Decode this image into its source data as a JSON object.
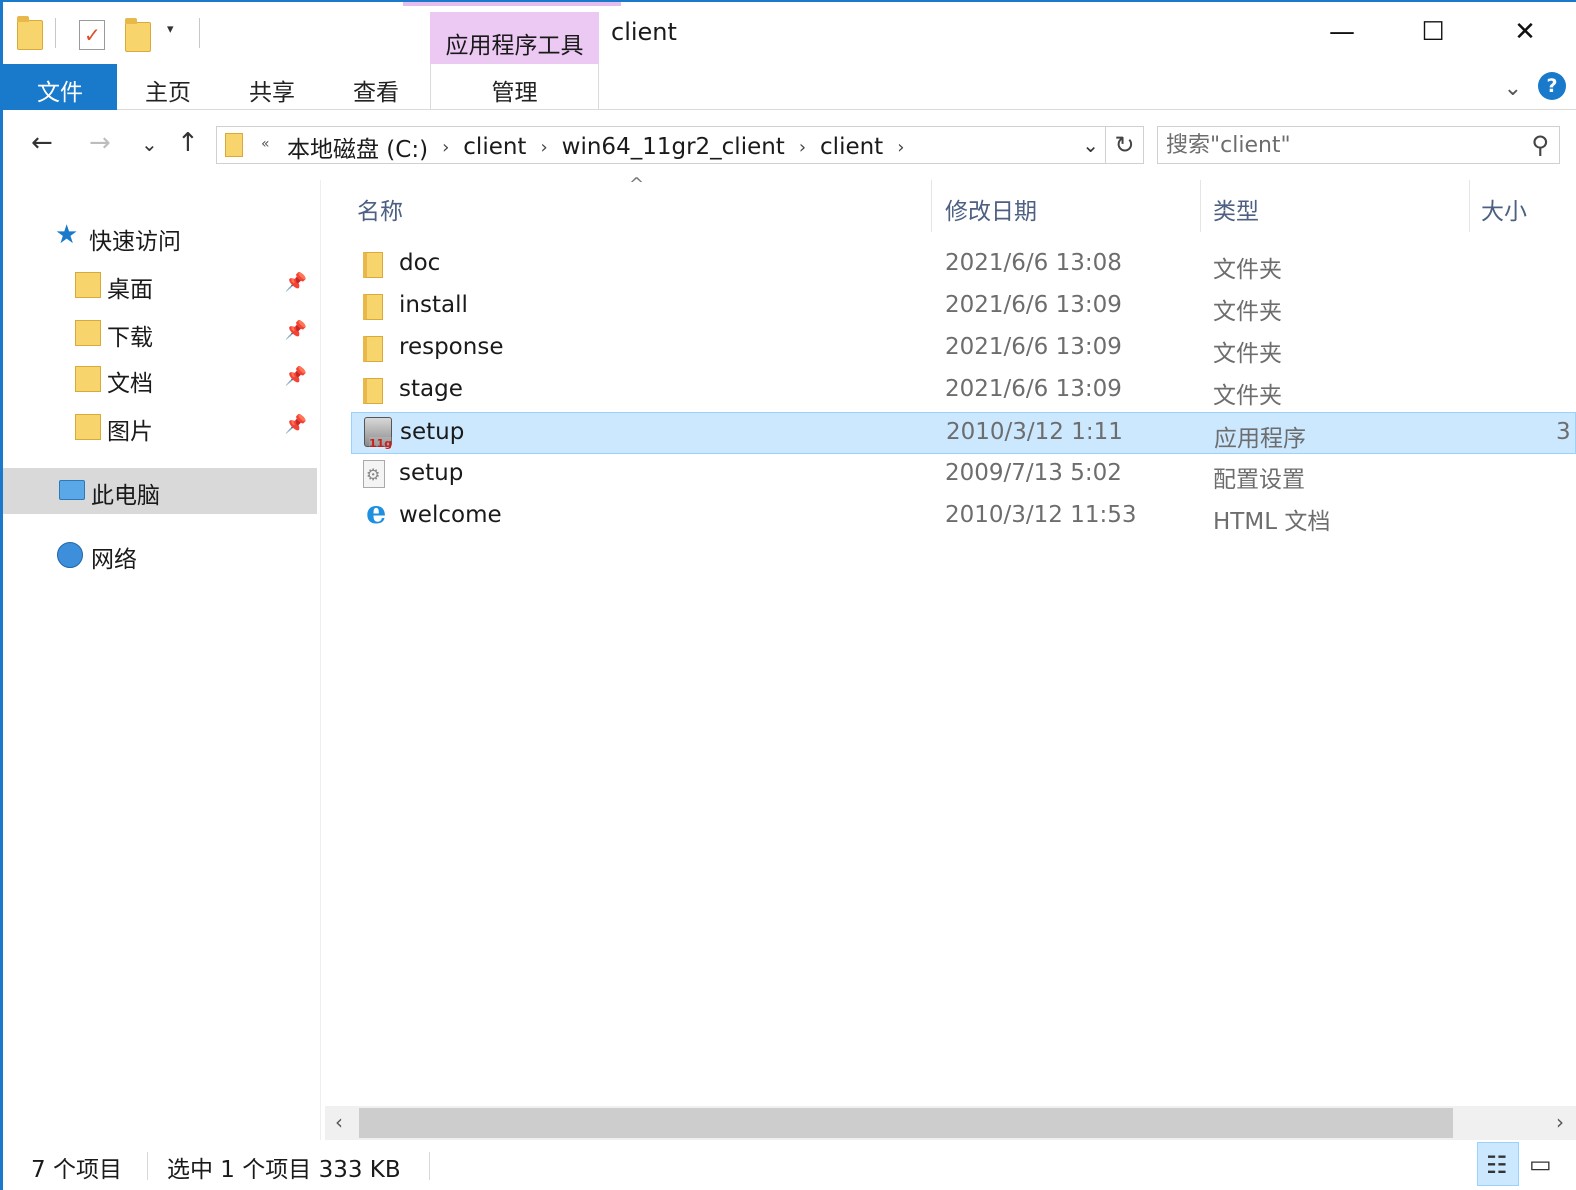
{
  "window": {
    "title": "client",
    "context_tab": "应用程序工具",
    "minimize": "—",
    "maximize": "☐",
    "close": "✕"
  },
  "ribbon": {
    "tabs": [
      "文件",
      "主页",
      "共享",
      "查看",
      "管理"
    ],
    "expand": "⌄",
    "help": "?"
  },
  "nav": {
    "back": "←",
    "forward": "→",
    "recent": "⌄",
    "up": "↑",
    "address_overflow": "«",
    "breadcrumbs": [
      "本地磁盘 (C:)",
      "client",
      "win64_11gr2_client",
      "client"
    ],
    "crumb_separator": "›",
    "address_dropdown": "⌄",
    "refresh": "↻",
    "search_placeholder": "搜索\"client\"",
    "search_icon": "⚲"
  },
  "navpane": {
    "quick_access": "快速访问",
    "items": [
      {
        "label": "桌面",
        "pinned": true
      },
      {
        "label": "下载",
        "pinned": true
      },
      {
        "label": "文档",
        "pinned": true
      },
      {
        "label": "图片",
        "pinned": true
      }
    ],
    "this_pc": "此电脑",
    "network": "网络",
    "pin_glyph": "📌"
  },
  "columns": {
    "name": "名称",
    "date": "修改日期",
    "type": "类型",
    "size": "大小",
    "sort_arrow": "^"
  },
  "files": [
    {
      "name": "doc",
      "date": "2021/6/6 13:08",
      "type": "文件夹",
      "size": "",
      "icon": "folder-icon"
    },
    {
      "name": "install",
      "date": "2021/6/6 13:09",
      "type": "文件夹",
      "size": "",
      "icon": "folder-icon"
    },
    {
      "name": "response",
      "date": "2021/6/6 13:09",
      "type": "文件夹",
      "size": "",
      "icon": "folder-icon"
    },
    {
      "name": "stage",
      "date": "2021/6/6 13:09",
      "type": "文件夹",
      "size": "",
      "icon": "folder-icon"
    },
    {
      "name": "setup",
      "date": "2010/3/12 1:11",
      "type": "应用程序",
      "size": "3",
      "icon": "oracle-setup-exe-icon"
    },
    {
      "name": "setup",
      "date": "2009/7/13 5:02",
      "type": "配置设置",
      "size": "",
      "icon": "config-file-icon"
    },
    {
      "name": "welcome",
      "date": "2010/3/12 11:53",
      "type": "HTML 文档",
      "size": "",
      "icon": "ie-html-icon"
    }
  ],
  "selected_index": 4,
  "scrollbar": {
    "left": "‹",
    "right": "›"
  },
  "status": {
    "count": "7 个项目",
    "selection": "选中 1 个项目  333 KB",
    "details_view": "☷",
    "large_icons_view": "▭"
  },
  "colors": {
    "accent": "#1979ca",
    "selection": "#cce8ff",
    "context_tab": "#ecc9f3"
  }
}
